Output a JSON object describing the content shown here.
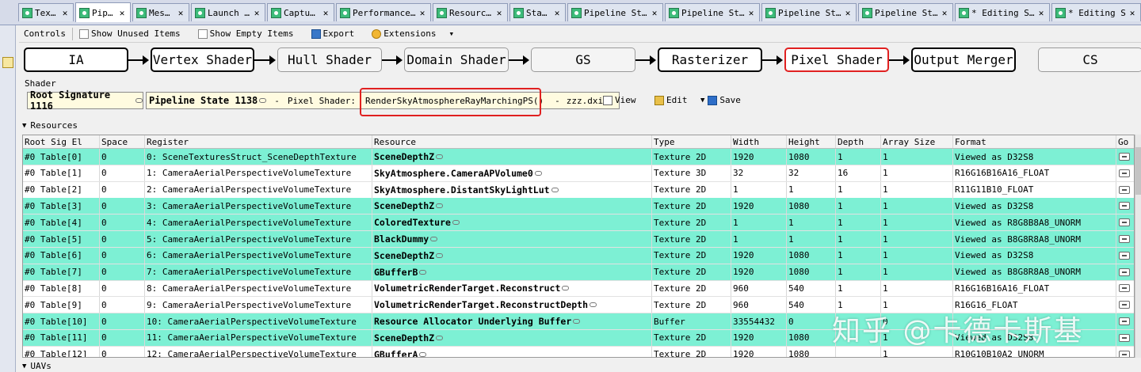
{
  "tabs": [
    {
      "label": "Tex…",
      "active": false
    },
    {
      "label": "Pip…",
      "active": true
    },
    {
      "label": "Mes…",
      "active": false
    },
    {
      "label": "Launch …",
      "active": false
    },
    {
      "label": "Captu…",
      "active": false
    },
    {
      "label": "Performance…",
      "active": false
    },
    {
      "label": "Resourc…",
      "active": false
    },
    {
      "label": "Sta…",
      "active": false
    },
    {
      "label": "Pipeline St…",
      "active": false
    },
    {
      "label": "Pipeline St…",
      "active": false
    },
    {
      "label": "Pipeline St…",
      "active": false
    },
    {
      "label": "Pipeline St…",
      "active": false
    },
    {
      "label": "* Editing S…",
      "active": false
    },
    {
      "label": "* Editing S…",
      "active": false
    }
  ],
  "toolbar": {
    "controls_label": "Controls",
    "show_unused_label": "Show Unused Items",
    "show_empty_label": "Show Empty Items",
    "export_label": "Export",
    "extensions_label": "Extensions",
    "dropdown_glyph": "▾"
  },
  "pipeline": {
    "stages": [
      {
        "label": "IA",
        "state": "normal"
      },
      {
        "label": "Vertex Shader",
        "state": "normal"
      },
      {
        "label": "Hull Shader",
        "state": "disabled"
      },
      {
        "label": "Domain Shader",
        "state": "disabled"
      },
      {
        "label": "GS",
        "state": "disabled"
      },
      {
        "label": "Rasterizer",
        "state": "normal"
      },
      {
        "label": "Pixel Shader",
        "state": "selected"
      },
      {
        "label": "Output Merger",
        "state": "normal"
      },
      {
        "label": "CS",
        "state": "disabled"
      }
    ]
  },
  "shader": {
    "section_label": "Shader",
    "root_signature": "Root Signature 1116",
    "pipeline_state": "Pipeline State 1138",
    "separator": "-",
    "stage_label": "Pixel  Shader:",
    "entry_point": "RenderSkyAtmosphereRayMarchingPS()",
    "file_name": "zzz.dxil",
    "view_label": "View",
    "edit_label": "Edit",
    "save_label": "Save"
  },
  "resources": {
    "section_label": "Resources",
    "columns": [
      "Root Sig El",
      "Space",
      "Register",
      "Resource",
      "Type",
      "Width",
      "Height",
      "Depth",
      "Array Size",
      "Format",
      "Go"
    ],
    "rows": [
      {
        "root": "#0 Table[0]",
        "space": "0",
        "register": "0: SceneTexturesStruct_SceneDepthTexture",
        "resource": "SceneDepthZ",
        "type": "Texture 2D",
        "width": "1920",
        "height": "1080",
        "depth": "1",
        "array": "1",
        "format": "Viewed as D32S8",
        "hl": true
      },
      {
        "root": "#0 Table[1]",
        "space": "0",
        "register": "1: CameraAerialPerspectiveVolumeTexture",
        "resource": "SkyAtmosphere.CameraAPVolume0",
        "type": "Texture 3D",
        "width": "32",
        "height": "32",
        "depth": "16",
        "array": "1",
        "format": "R16G16B16A16_FLOAT",
        "hl": false
      },
      {
        "root": "#0 Table[2]",
        "space": "0",
        "register": "2: CameraAerialPerspectiveVolumeTexture",
        "resource": "SkyAtmosphere.DistantSkyLightLut",
        "type": "Texture 2D",
        "width": "1",
        "height": "1",
        "depth": "1",
        "array": "1",
        "format": "R11G11B10_FLOAT",
        "hl": false
      },
      {
        "root": "#0 Table[3]",
        "space": "0",
        "register": "3: CameraAerialPerspectiveVolumeTexture",
        "resource": "SceneDepthZ",
        "type": "Texture 2D",
        "width": "1920",
        "height": "1080",
        "depth": "1",
        "array": "1",
        "format": "Viewed as D32S8",
        "hl": true
      },
      {
        "root": "#0 Table[4]",
        "space": "0",
        "register": "4: CameraAerialPerspectiveVolumeTexture",
        "resource": "ColoredTexture",
        "type": "Texture 2D",
        "width": "1",
        "height": "1",
        "depth": "1",
        "array": "1",
        "format": "Viewed as R8G8B8A8_UNORM",
        "hl": true
      },
      {
        "root": "#0 Table[5]",
        "space": "0",
        "register": "5: CameraAerialPerspectiveVolumeTexture",
        "resource": "BlackDummy",
        "type": "Texture 2D",
        "width": "1",
        "height": "1",
        "depth": "1",
        "array": "1",
        "format": "Viewed as B8G8R8A8_UNORM",
        "hl": true
      },
      {
        "root": "#0 Table[6]",
        "space": "0",
        "register": "6: CameraAerialPerspectiveVolumeTexture",
        "resource": "SceneDepthZ",
        "type": "Texture 2D",
        "width": "1920",
        "height": "1080",
        "depth": "1",
        "array": "1",
        "format": "Viewed as D32S8",
        "hl": true
      },
      {
        "root": "#0 Table[7]",
        "space": "0",
        "register": "7: CameraAerialPerspectiveVolumeTexture",
        "resource": "GBufferB",
        "type": "Texture 2D",
        "width": "1920",
        "height": "1080",
        "depth": "1",
        "array": "1",
        "format": "Viewed as B8G8R8A8_UNORM",
        "hl": true
      },
      {
        "root": "#0 Table[8]",
        "space": "0",
        "register": "8: CameraAerialPerspectiveVolumeTexture",
        "resource": "VolumetricRenderTarget.Reconstruct",
        "type": "Texture 2D",
        "width": "960",
        "height": "540",
        "depth": "1",
        "array": "1",
        "format": "R16G16B16A16_FLOAT",
        "hl": false
      },
      {
        "root": "#0 Table[9]",
        "space": "0",
        "register": "9: CameraAerialPerspectiveVolumeTexture",
        "resource": "VolumetricRenderTarget.ReconstructDepth",
        "type": "Texture 2D",
        "width": "960",
        "height": "540",
        "depth": "1",
        "array": "1",
        "format": "R16G16_FLOAT",
        "hl": false
      },
      {
        "root": "#0 Table[10]",
        "space": "0",
        "register": "10: CameraAerialPerspectiveVolumeTexture",
        "resource": "Resource Allocator Underlying Buffer",
        "type": "Buffer",
        "width": "33554432",
        "height": "0",
        "depth": "",
        "array": "0",
        "format": "",
        "hl": true
      },
      {
        "root": "#0 Table[11]",
        "space": "0",
        "register": "11: CameraAerialPerspectiveVolumeTexture",
        "resource": "SceneDepthZ",
        "type": "Texture 2D",
        "width": "1920",
        "height": "1080",
        "depth": "",
        "array": "1",
        "format": "Viewed as D32S8",
        "hl": true
      },
      {
        "root": "#0 Table[12]",
        "space": "0",
        "register": "12: CameraAerialPerspectiveVolumeTexture",
        "resource": "GBufferA",
        "type": "Texture 2D",
        "width": "1920",
        "height": "1080",
        "depth": "",
        "array": "1",
        "format": "R10G10B10A2_UNORM",
        "hl": false
      }
    ]
  },
  "uavs": {
    "section_label": "UAVs"
  },
  "watermark": "知乎 @卡德卡斯基",
  "colors": {
    "highlight_row": "#7df0d4",
    "selected_stage": "#e02020",
    "tab_icon": "#3dbb7a"
  }
}
